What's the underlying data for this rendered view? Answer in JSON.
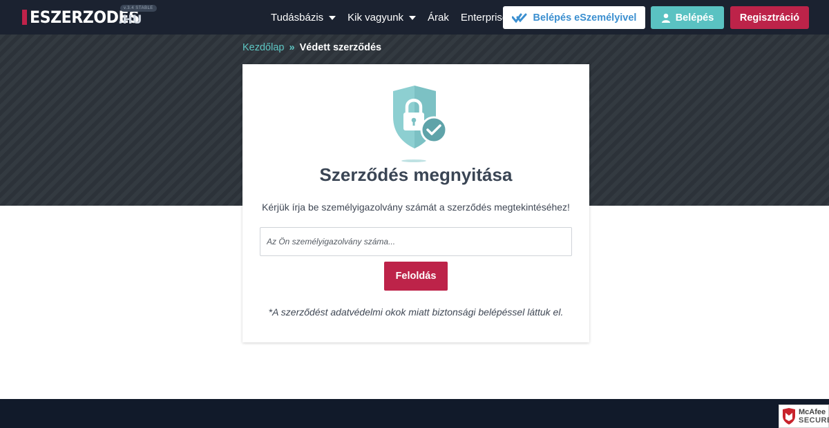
{
  "header": {
    "logo_main": "ESZERZODES",
    "logo_tld": ".HU",
    "version_badge": "v.3.4 STABLE",
    "nav": [
      {
        "label": "Tudásbázis",
        "dropdown": true
      },
      {
        "label": "Kik vagyunk",
        "dropdown": true
      },
      {
        "label": "Árak",
        "dropdown": false
      },
      {
        "label": "Enterprise",
        "dropdown": false
      }
    ],
    "eid_button": "Belépés eSzemélyivel",
    "login_button": "Belépés",
    "register_button": "Regisztráció"
  },
  "breadcrumb": {
    "home": "Kezdőlap",
    "separator": "»",
    "current": "Védett szerződés"
  },
  "card": {
    "icon": "shield-lock-check-icon",
    "title": "Szerződés megnyitása",
    "description": "Kérjük írja be személyigazolvány számát a szerződés megtekintéséhez!",
    "input_placeholder": "Az Ön személyigazolvány száma...",
    "input_value": "",
    "unlock_button": "Feloldás",
    "note": "*A szerződést adatvédelmi okok miatt biztonsági belépéssel láttuk el."
  },
  "badge": {
    "brand": "McAfee",
    "secure": "SECURE"
  },
  "colors": {
    "navbar": "#1b2230",
    "accent_teal": "#5ac2c2",
    "accent_blue": "#3b8fd0",
    "accent_red": "#bd2349",
    "hero": "#2e353c",
    "footer": "#111a2a"
  }
}
